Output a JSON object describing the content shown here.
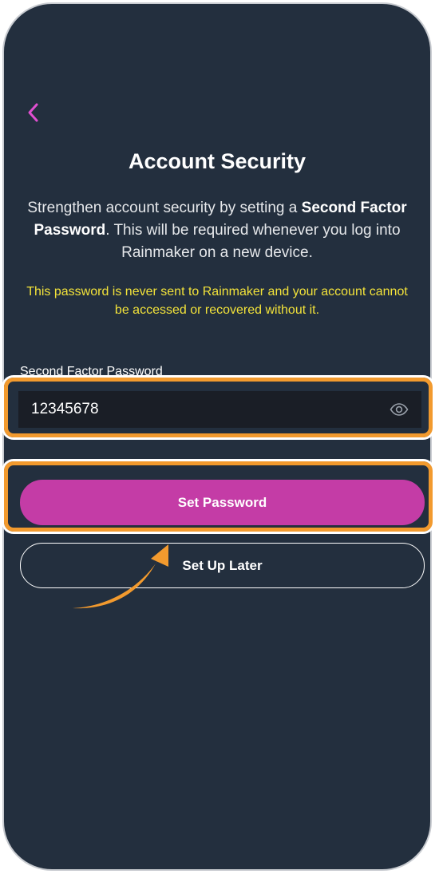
{
  "header": {
    "back_icon": "chevron-left-icon",
    "title": "Account Security"
  },
  "intro": {
    "text_1": "Strengthen account security by setting a ",
    "bold_1": "Second Factor Password",
    "text_2": ". This will be required whenever you log into Rainmaker on a new device."
  },
  "warning": "This password is never sent to Rainmaker and your account cannot be accessed or recovered without it.",
  "password_field": {
    "label": "Second Factor Password",
    "value": "12345678",
    "toggle_icon": "eye-icon"
  },
  "buttons": {
    "set_password": "Set Password",
    "set_up_later": "Set Up Later"
  },
  "colors": {
    "background": "#232f3e",
    "accent": "#c43ca6",
    "warning": "#f2e23a",
    "highlight": "#f29a2e",
    "back_chevron": "#e04fd0"
  }
}
